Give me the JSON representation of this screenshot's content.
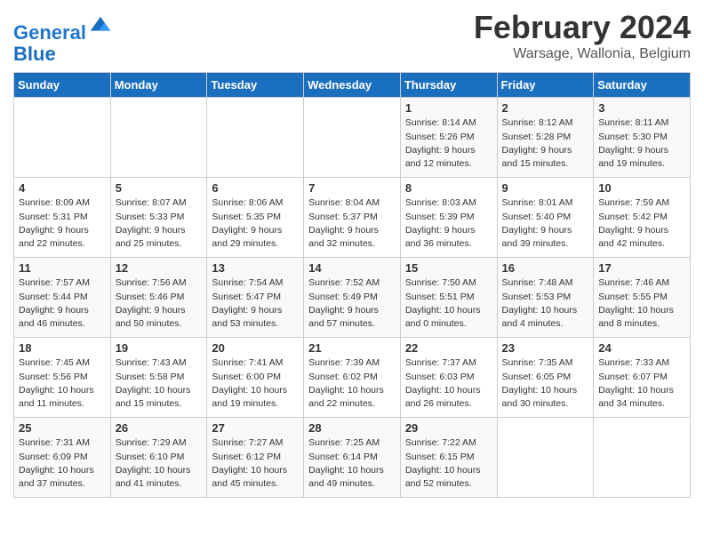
{
  "logo": {
    "line1": "General",
    "line2": "Blue",
    "icon_color": "#2277cc"
  },
  "title": "February 2024",
  "location": "Warsage, Wallonia, Belgium",
  "weekdays": [
    "Sunday",
    "Monday",
    "Tuesday",
    "Wednesday",
    "Thursday",
    "Friday",
    "Saturday"
  ],
  "weeks": [
    [
      {
        "day": "",
        "info": ""
      },
      {
        "day": "",
        "info": ""
      },
      {
        "day": "",
        "info": ""
      },
      {
        "day": "",
        "info": ""
      },
      {
        "day": "1",
        "info": "Sunrise: 8:14 AM\nSunset: 5:26 PM\nDaylight: 9 hours\nand 12 minutes."
      },
      {
        "day": "2",
        "info": "Sunrise: 8:12 AM\nSunset: 5:28 PM\nDaylight: 9 hours\nand 15 minutes."
      },
      {
        "day": "3",
        "info": "Sunrise: 8:11 AM\nSunset: 5:30 PM\nDaylight: 9 hours\nand 19 minutes."
      }
    ],
    [
      {
        "day": "4",
        "info": "Sunrise: 8:09 AM\nSunset: 5:31 PM\nDaylight: 9 hours\nand 22 minutes."
      },
      {
        "day": "5",
        "info": "Sunrise: 8:07 AM\nSunset: 5:33 PM\nDaylight: 9 hours\nand 25 minutes."
      },
      {
        "day": "6",
        "info": "Sunrise: 8:06 AM\nSunset: 5:35 PM\nDaylight: 9 hours\nand 29 minutes."
      },
      {
        "day": "7",
        "info": "Sunrise: 8:04 AM\nSunset: 5:37 PM\nDaylight: 9 hours\nand 32 minutes."
      },
      {
        "day": "8",
        "info": "Sunrise: 8:03 AM\nSunset: 5:39 PM\nDaylight: 9 hours\nand 36 minutes."
      },
      {
        "day": "9",
        "info": "Sunrise: 8:01 AM\nSunset: 5:40 PM\nDaylight: 9 hours\nand 39 minutes."
      },
      {
        "day": "10",
        "info": "Sunrise: 7:59 AM\nSunset: 5:42 PM\nDaylight: 9 hours\nand 42 minutes."
      }
    ],
    [
      {
        "day": "11",
        "info": "Sunrise: 7:57 AM\nSunset: 5:44 PM\nDaylight: 9 hours\nand 46 minutes."
      },
      {
        "day": "12",
        "info": "Sunrise: 7:56 AM\nSunset: 5:46 PM\nDaylight: 9 hours\nand 50 minutes."
      },
      {
        "day": "13",
        "info": "Sunrise: 7:54 AM\nSunset: 5:47 PM\nDaylight: 9 hours\nand 53 minutes."
      },
      {
        "day": "14",
        "info": "Sunrise: 7:52 AM\nSunset: 5:49 PM\nDaylight: 9 hours\nand 57 minutes."
      },
      {
        "day": "15",
        "info": "Sunrise: 7:50 AM\nSunset: 5:51 PM\nDaylight: 10 hours\nand 0 minutes."
      },
      {
        "day": "16",
        "info": "Sunrise: 7:48 AM\nSunset: 5:53 PM\nDaylight: 10 hours\nand 4 minutes."
      },
      {
        "day": "17",
        "info": "Sunrise: 7:46 AM\nSunset: 5:55 PM\nDaylight: 10 hours\nand 8 minutes."
      }
    ],
    [
      {
        "day": "18",
        "info": "Sunrise: 7:45 AM\nSunset: 5:56 PM\nDaylight: 10 hours\nand 11 minutes."
      },
      {
        "day": "19",
        "info": "Sunrise: 7:43 AM\nSunset: 5:58 PM\nDaylight: 10 hours\nand 15 minutes."
      },
      {
        "day": "20",
        "info": "Sunrise: 7:41 AM\nSunset: 6:00 PM\nDaylight: 10 hours\nand 19 minutes."
      },
      {
        "day": "21",
        "info": "Sunrise: 7:39 AM\nSunset: 6:02 PM\nDaylight: 10 hours\nand 22 minutes."
      },
      {
        "day": "22",
        "info": "Sunrise: 7:37 AM\nSunset: 6:03 PM\nDaylight: 10 hours\nand 26 minutes."
      },
      {
        "day": "23",
        "info": "Sunrise: 7:35 AM\nSunset: 6:05 PM\nDaylight: 10 hours\nand 30 minutes."
      },
      {
        "day": "24",
        "info": "Sunrise: 7:33 AM\nSunset: 6:07 PM\nDaylight: 10 hours\nand 34 minutes."
      }
    ],
    [
      {
        "day": "25",
        "info": "Sunrise: 7:31 AM\nSunset: 6:09 PM\nDaylight: 10 hours\nand 37 minutes."
      },
      {
        "day": "26",
        "info": "Sunrise: 7:29 AM\nSunset: 6:10 PM\nDaylight: 10 hours\nand 41 minutes."
      },
      {
        "day": "27",
        "info": "Sunrise: 7:27 AM\nSunset: 6:12 PM\nDaylight: 10 hours\nand 45 minutes."
      },
      {
        "day": "28",
        "info": "Sunrise: 7:25 AM\nSunset: 6:14 PM\nDaylight: 10 hours\nand 49 minutes."
      },
      {
        "day": "29",
        "info": "Sunrise: 7:22 AM\nSunset: 6:15 PM\nDaylight: 10 hours\nand 52 minutes."
      },
      {
        "day": "",
        "info": ""
      },
      {
        "day": "",
        "info": ""
      }
    ]
  ]
}
